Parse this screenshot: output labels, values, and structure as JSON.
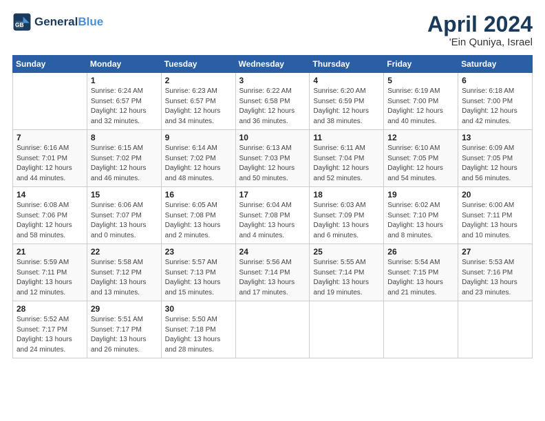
{
  "logo": {
    "line1": "General",
    "line2": "Blue"
  },
  "title": "April 2024",
  "location": "'Ein Quniya, Israel",
  "weekdays": [
    "Sunday",
    "Monday",
    "Tuesday",
    "Wednesday",
    "Thursday",
    "Friday",
    "Saturday"
  ],
  "weeks": [
    [
      null,
      {
        "day": "1",
        "sunrise": "6:24 AM",
        "sunset": "6:57 PM",
        "daylight": "12 hours and 32 minutes."
      },
      {
        "day": "2",
        "sunrise": "6:23 AM",
        "sunset": "6:57 PM",
        "daylight": "12 hours and 34 minutes."
      },
      {
        "day": "3",
        "sunrise": "6:22 AM",
        "sunset": "6:58 PM",
        "daylight": "12 hours and 36 minutes."
      },
      {
        "day": "4",
        "sunrise": "6:20 AM",
        "sunset": "6:59 PM",
        "daylight": "12 hours and 38 minutes."
      },
      {
        "day": "5",
        "sunrise": "6:19 AM",
        "sunset": "7:00 PM",
        "daylight": "12 hours and 40 minutes."
      },
      {
        "day": "6",
        "sunrise": "6:18 AM",
        "sunset": "7:00 PM",
        "daylight": "12 hours and 42 minutes."
      }
    ],
    [
      {
        "day": "7",
        "sunrise": "6:16 AM",
        "sunset": "7:01 PM",
        "daylight": "12 hours and 44 minutes."
      },
      {
        "day": "8",
        "sunrise": "6:15 AM",
        "sunset": "7:02 PM",
        "daylight": "12 hours and 46 minutes."
      },
      {
        "day": "9",
        "sunrise": "6:14 AM",
        "sunset": "7:02 PM",
        "daylight": "12 hours and 48 minutes."
      },
      {
        "day": "10",
        "sunrise": "6:13 AM",
        "sunset": "7:03 PM",
        "daylight": "12 hours and 50 minutes."
      },
      {
        "day": "11",
        "sunrise": "6:11 AM",
        "sunset": "7:04 PM",
        "daylight": "12 hours and 52 minutes."
      },
      {
        "day": "12",
        "sunrise": "6:10 AM",
        "sunset": "7:05 PM",
        "daylight": "12 hours and 54 minutes."
      },
      {
        "day": "13",
        "sunrise": "6:09 AM",
        "sunset": "7:05 PM",
        "daylight": "12 hours and 56 minutes."
      }
    ],
    [
      {
        "day": "14",
        "sunrise": "6:08 AM",
        "sunset": "7:06 PM",
        "daylight": "12 hours and 58 minutes."
      },
      {
        "day": "15",
        "sunrise": "6:06 AM",
        "sunset": "7:07 PM",
        "daylight": "13 hours and 0 minutes."
      },
      {
        "day": "16",
        "sunrise": "6:05 AM",
        "sunset": "7:08 PM",
        "daylight": "13 hours and 2 minutes."
      },
      {
        "day": "17",
        "sunrise": "6:04 AM",
        "sunset": "7:08 PM",
        "daylight": "13 hours and 4 minutes."
      },
      {
        "day": "18",
        "sunrise": "6:03 AM",
        "sunset": "7:09 PM",
        "daylight": "13 hours and 6 minutes."
      },
      {
        "day": "19",
        "sunrise": "6:02 AM",
        "sunset": "7:10 PM",
        "daylight": "13 hours and 8 minutes."
      },
      {
        "day": "20",
        "sunrise": "6:00 AM",
        "sunset": "7:11 PM",
        "daylight": "13 hours and 10 minutes."
      }
    ],
    [
      {
        "day": "21",
        "sunrise": "5:59 AM",
        "sunset": "7:11 PM",
        "daylight": "13 hours and 12 minutes."
      },
      {
        "day": "22",
        "sunrise": "5:58 AM",
        "sunset": "7:12 PM",
        "daylight": "13 hours and 13 minutes."
      },
      {
        "day": "23",
        "sunrise": "5:57 AM",
        "sunset": "7:13 PM",
        "daylight": "13 hours and 15 minutes."
      },
      {
        "day": "24",
        "sunrise": "5:56 AM",
        "sunset": "7:14 PM",
        "daylight": "13 hours and 17 minutes."
      },
      {
        "day": "25",
        "sunrise": "5:55 AM",
        "sunset": "7:14 PM",
        "daylight": "13 hours and 19 minutes."
      },
      {
        "day": "26",
        "sunrise": "5:54 AM",
        "sunset": "7:15 PM",
        "daylight": "13 hours and 21 minutes."
      },
      {
        "day": "27",
        "sunrise": "5:53 AM",
        "sunset": "7:16 PM",
        "daylight": "13 hours and 23 minutes."
      }
    ],
    [
      {
        "day": "28",
        "sunrise": "5:52 AM",
        "sunset": "7:17 PM",
        "daylight": "13 hours and 24 minutes."
      },
      {
        "day": "29",
        "sunrise": "5:51 AM",
        "sunset": "7:17 PM",
        "daylight": "13 hours and 26 minutes."
      },
      {
        "day": "30",
        "sunrise": "5:50 AM",
        "sunset": "7:18 PM",
        "daylight": "13 hours and 28 minutes."
      },
      null,
      null,
      null,
      null
    ]
  ],
  "labels": {
    "sunrise": "Sunrise:",
    "sunset": "Sunset:",
    "daylight": "Daylight:"
  }
}
